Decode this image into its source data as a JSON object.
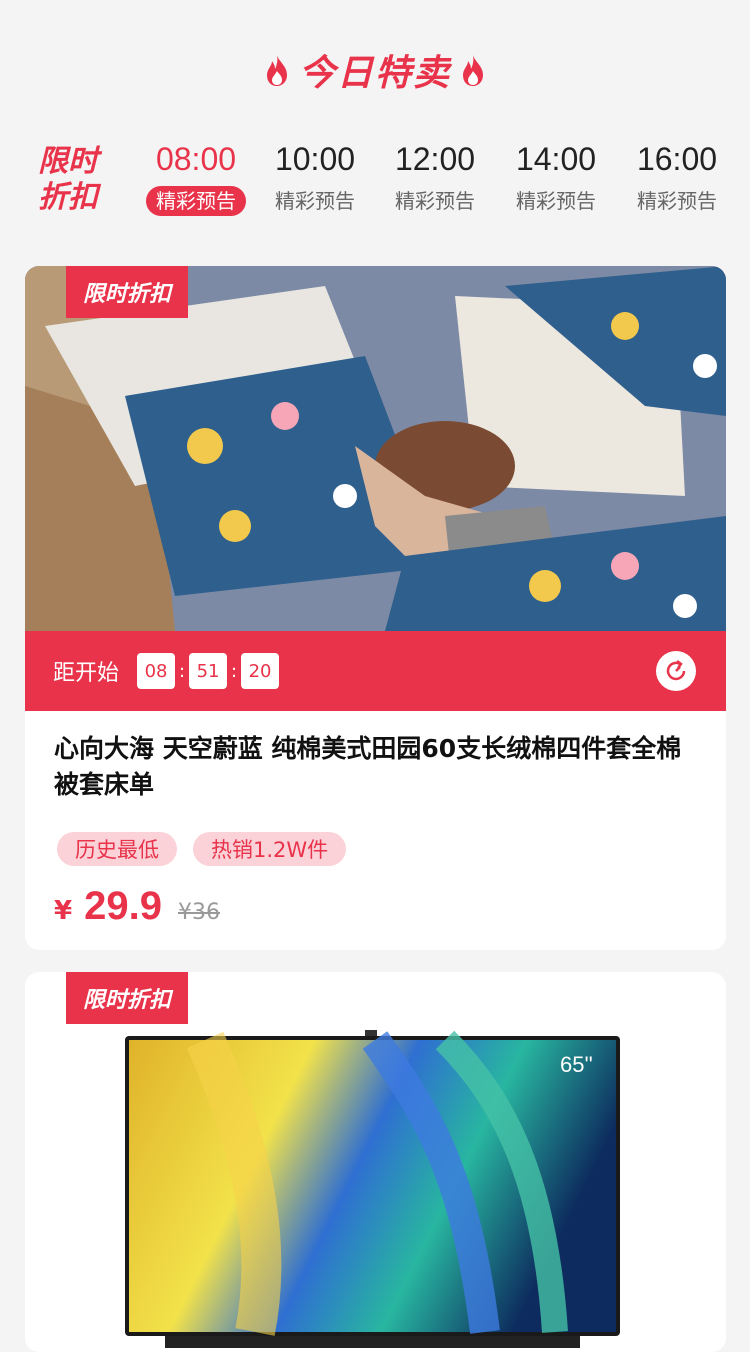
{
  "header": {
    "title": "今日特卖"
  },
  "tabs": {
    "promo_label": "限时折扣",
    "items": [
      {
        "time": "08:00",
        "sub": "精彩预告",
        "active": true
      },
      {
        "time": "10:00",
        "sub": "精彩预告",
        "active": false
      },
      {
        "time": "12:00",
        "sub": "精彩预告",
        "active": false
      },
      {
        "time": "14:00",
        "sub": "精彩预告",
        "active": false
      },
      {
        "time": "16:00",
        "sub": "精彩预告",
        "active": false
      }
    ]
  },
  "products": [
    {
      "tag": "限时折扣",
      "countdown": {
        "label": "距开始",
        "h": "08",
        "m": "51",
        "s": "20"
      },
      "title": "心向大海 天空蔚蓝 纯棉美式田园60支长绒棉四件套全棉被套床单",
      "badges": [
        "历史最低",
        "热销1.2W件"
      ],
      "currency": "¥",
      "price": "29.9",
      "original_price": "¥36"
    },
    {
      "tag": "限时折扣",
      "tv_size": "65''"
    }
  ],
  "colors": {
    "accent": "#e8334a",
    "badge_bg": "#fbd2d8"
  },
  "icons": {
    "flame": "flame-icon",
    "refresh": "refresh-icon"
  }
}
